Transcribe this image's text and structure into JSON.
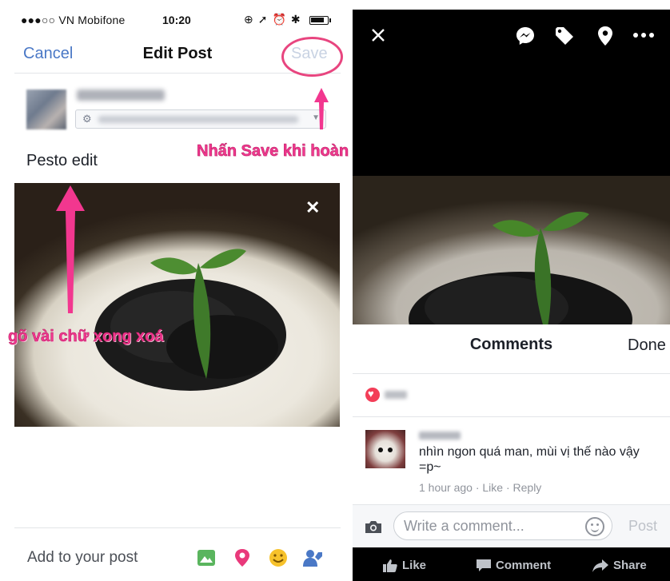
{
  "left": {
    "status_bar": {
      "carrier": "●●●○○ VN Mobifone",
      "time": "10:20"
    },
    "nav": {
      "cancel": "Cancel",
      "title": "Edit Post",
      "save": "Save"
    },
    "post_text": "Pesto edit",
    "annotations": {
      "save_hint": "Nhấn Save khi hoàn thành",
      "type_hint": "gõ vài chữ xong xoá"
    },
    "add_to_post": "Add to your post",
    "colors": {
      "accent": "#4a78c6",
      "annotation": "#f2378f"
    }
  },
  "right": {
    "sheet": {
      "title": "Comments",
      "done": "Done"
    },
    "comment": {
      "text": "nhìn ngon quá man, mùi vị thế nào vậy =p~",
      "meta": "1 hour ago · Like · Reply"
    },
    "composer": {
      "placeholder": "Write a comment...",
      "post": "Post"
    },
    "actions": {
      "like": "Like",
      "comment": "Comment",
      "share": "Share"
    }
  }
}
